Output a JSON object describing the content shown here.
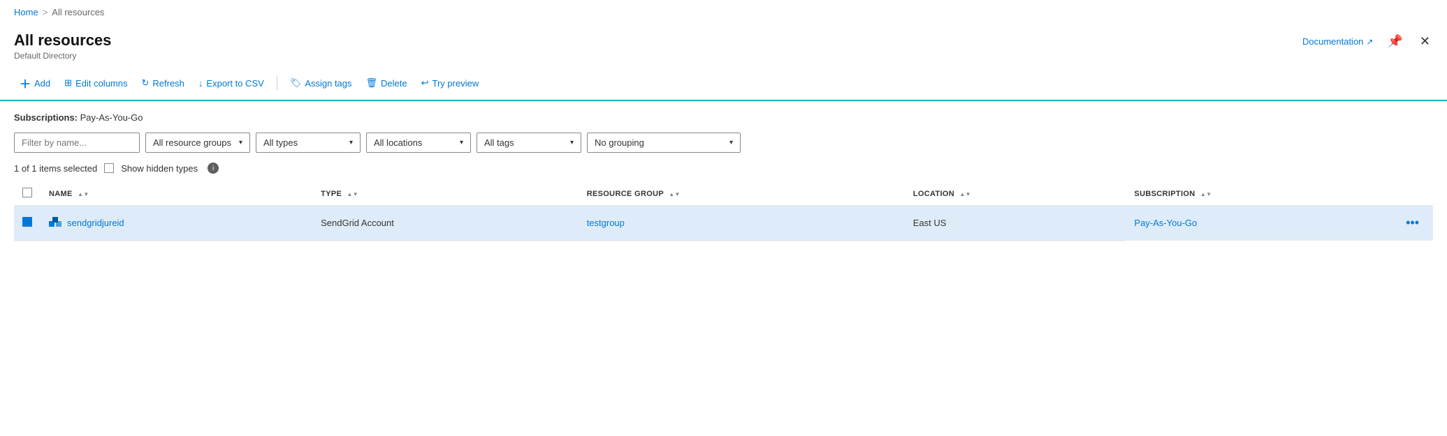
{
  "breadcrumb": {
    "home": "Home",
    "separator": ">",
    "current": "All resources"
  },
  "page": {
    "title": "All resources",
    "subtitle": "Default Directory"
  },
  "header_actions": {
    "documentation_label": "Documentation",
    "pin_icon": "📌",
    "close_icon": "✕"
  },
  "toolbar": {
    "add_label": "Add",
    "edit_columns_label": "Edit columns",
    "refresh_label": "Refresh",
    "export_label": "Export to CSV",
    "assign_tags_label": "Assign tags",
    "delete_label": "Delete",
    "try_preview_label": "Try preview"
  },
  "subscriptions": {
    "label": "Subscriptions:",
    "value": "Pay-As-You-Go"
  },
  "filters": {
    "name_placeholder": "Filter by name...",
    "resource_groups": "All resource groups",
    "types": "All types",
    "locations": "All locations",
    "tags": "All tags",
    "grouping": "No grouping"
  },
  "selection": {
    "count_label": "1 of 1 items selected",
    "show_hidden_label": "Show hidden types"
  },
  "table": {
    "columns": [
      {
        "key": "name",
        "label": "NAME"
      },
      {
        "key": "type",
        "label": "TYPE"
      },
      {
        "key": "resource_group",
        "label": "RESOURCE GROUP"
      },
      {
        "key": "location",
        "label": "LOCATION"
      },
      {
        "key": "subscription",
        "label": "SUBSCRIPTION"
      }
    ],
    "rows": [
      {
        "name": "sendgridjureid",
        "type": "SendGrid Account",
        "resource_group": "testgroup",
        "location": "East US",
        "subscription": "Pay-As-You-Go",
        "selected": true
      }
    ]
  }
}
